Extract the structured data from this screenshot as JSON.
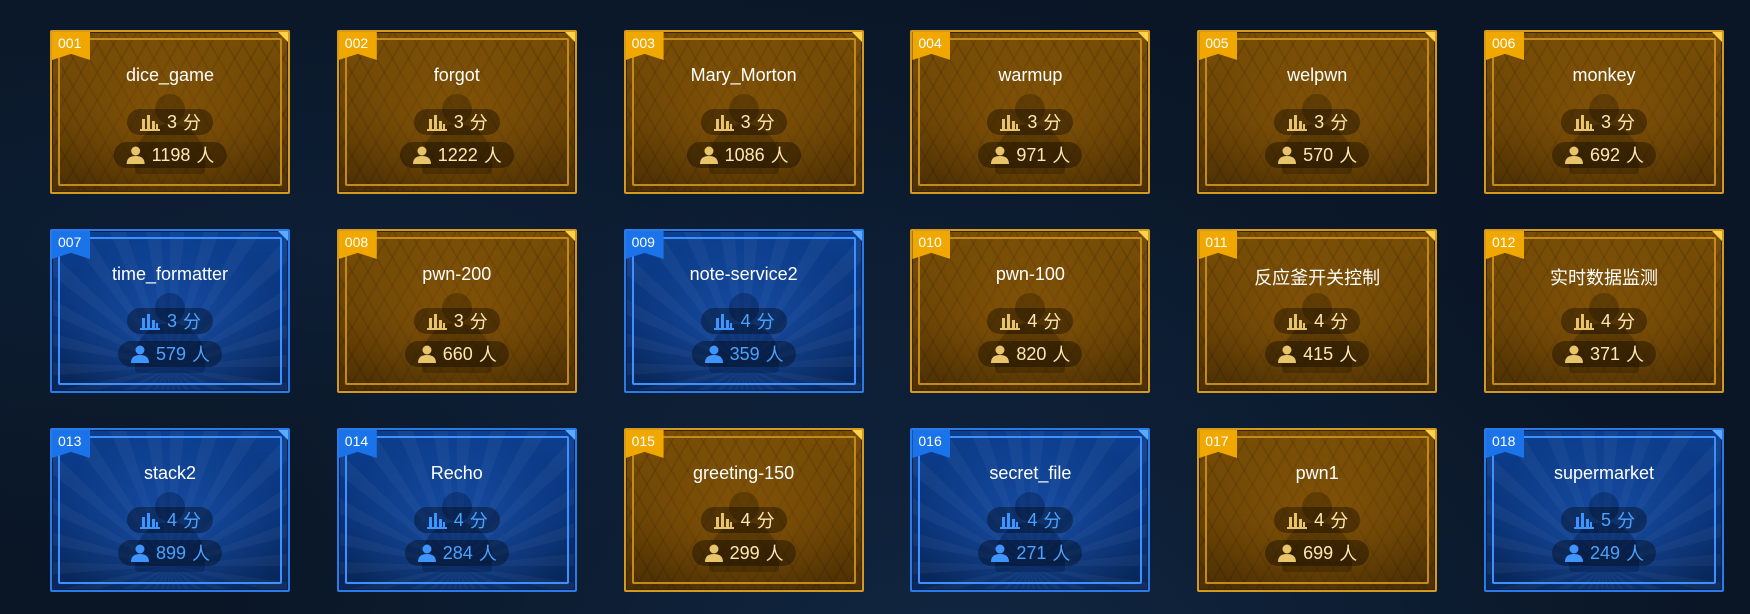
{
  "colors": {
    "gold_accent": "#f0a800",
    "blue_accent": "#1a73e8",
    "gold_text": "#ffe8b0",
    "blue_text": "#4aa3ff"
  },
  "icons": {
    "score": "bar-chart-icon",
    "people": "user-icon"
  },
  "units": {
    "score": "分",
    "people": "人"
  },
  "challenges": [
    {
      "number": "001",
      "name": "dice_game",
      "score": "3",
      "people": "1198",
      "theme": "gold"
    },
    {
      "number": "002",
      "name": "forgot",
      "score": "3",
      "people": "1222",
      "theme": "gold"
    },
    {
      "number": "003",
      "name": "Mary_Morton",
      "score": "3",
      "people": "1086",
      "theme": "gold"
    },
    {
      "number": "004",
      "name": "warmup",
      "score": "3",
      "people": "971",
      "theme": "gold"
    },
    {
      "number": "005",
      "name": "welpwn",
      "score": "3",
      "people": "570",
      "theme": "gold"
    },
    {
      "number": "006",
      "name": "monkey",
      "score": "3",
      "people": "692",
      "theme": "gold"
    },
    {
      "number": "007",
      "name": "time_formatter",
      "score": "3",
      "people": "579",
      "theme": "blue"
    },
    {
      "number": "008",
      "name": "pwn-200",
      "score": "3",
      "people": "660",
      "theme": "gold"
    },
    {
      "number": "009",
      "name": "note-service2",
      "score": "4",
      "people": "359",
      "theme": "blue"
    },
    {
      "number": "010",
      "name": "pwn-100",
      "score": "4",
      "people": "820",
      "theme": "gold"
    },
    {
      "number": "011",
      "name": "反应釜开关控制",
      "score": "4",
      "people": "415",
      "theme": "gold"
    },
    {
      "number": "012",
      "name": "实时数据监测",
      "score": "4",
      "people": "371",
      "theme": "gold"
    },
    {
      "number": "013",
      "name": "stack2",
      "score": "4",
      "people": "899",
      "theme": "blue"
    },
    {
      "number": "014",
      "name": "Recho",
      "score": "4",
      "people": "284",
      "theme": "blue"
    },
    {
      "number": "015",
      "name": "greeting-150",
      "score": "4",
      "people": "299",
      "theme": "gold"
    },
    {
      "number": "016",
      "name": "secret_file",
      "score": "4",
      "people": "271",
      "theme": "blue"
    },
    {
      "number": "017",
      "name": "pwn1",
      "score": "4",
      "people": "699",
      "theme": "gold"
    },
    {
      "number": "018",
      "name": "supermarket",
      "score": "5",
      "people": "249",
      "theme": "blue"
    }
  ]
}
